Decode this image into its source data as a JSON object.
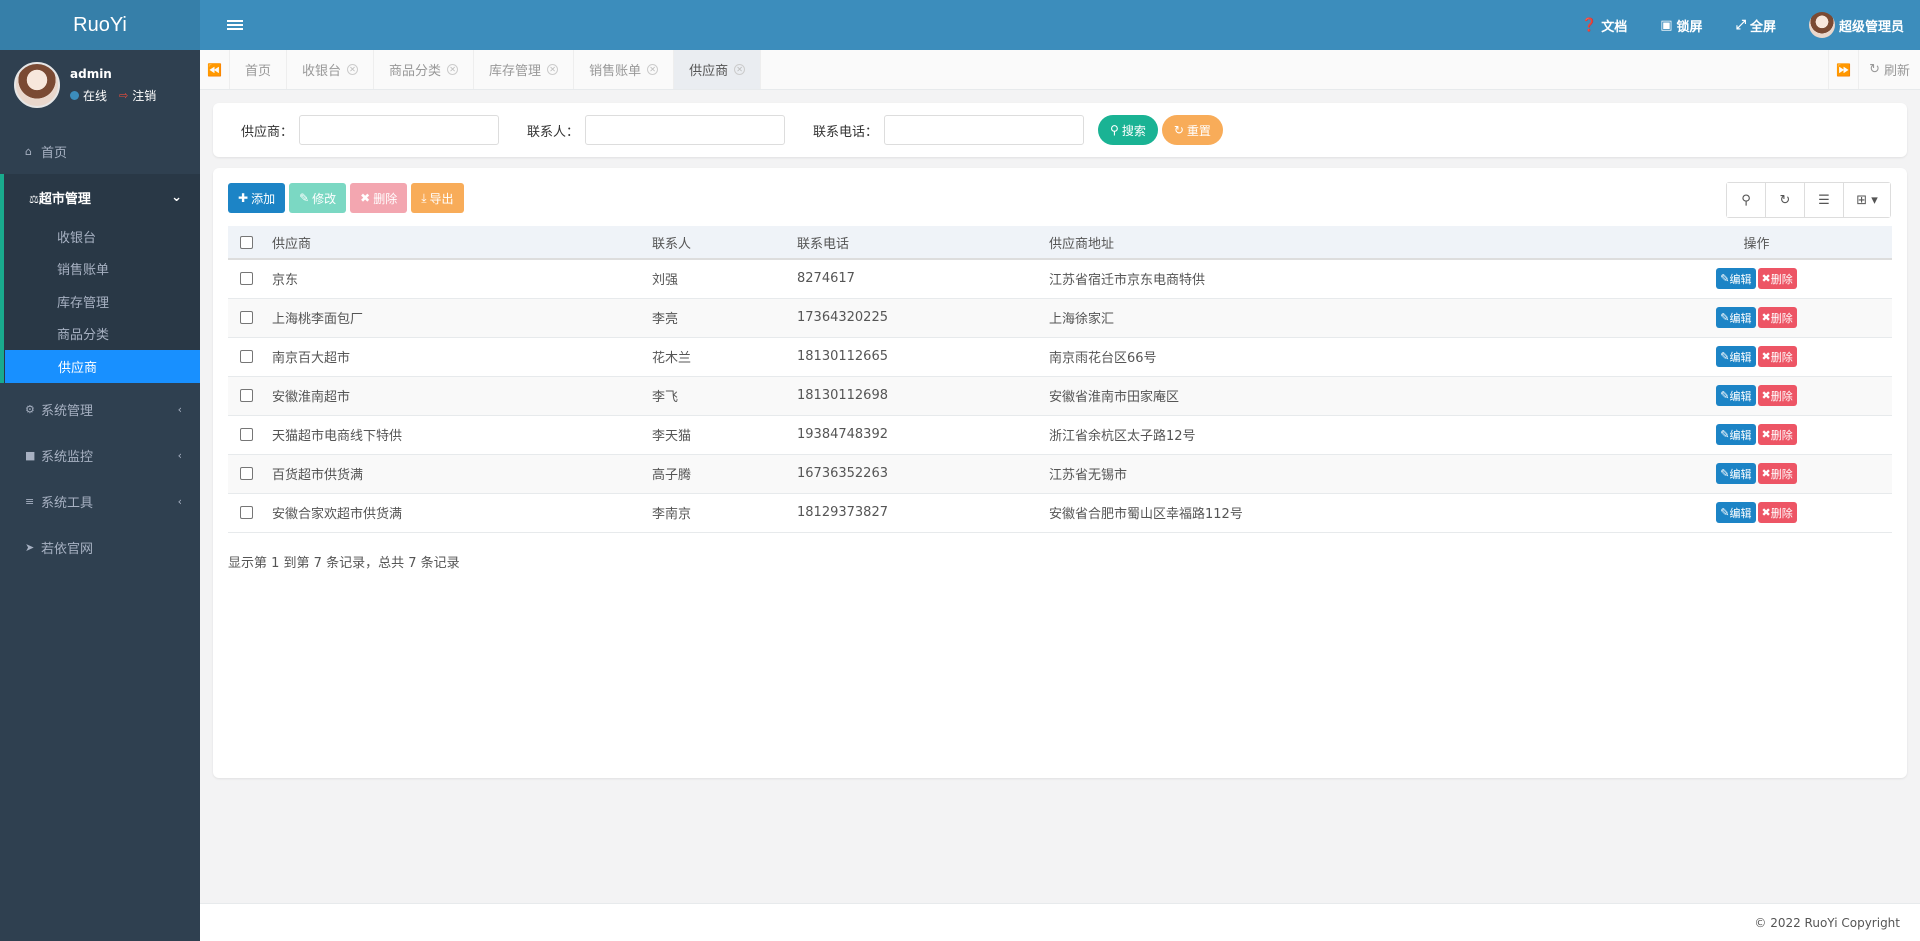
{
  "app": {
    "logo": "RuoYi"
  },
  "user": {
    "name": "admin",
    "status_online": "在线",
    "logout": "注销"
  },
  "sidebar": {
    "home": "首页",
    "supermarket": "超市管理",
    "sub": [
      "收银台",
      "销售账单",
      "库存管理",
      "商品分类",
      "供应商"
    ],
    "system": "系统管理",
    "monitor": "系统监控",
    "tools": "系统工具",
    "site": "若依官网"
  },
  "topbar": {
    "docs": "文档",
    "lock": "锁屏",
    "fullscreen": "全屏",
    "user": "超级管理员"
  },
  "tabs": {
    "items": [
      "首页",
      "收银台",
      "商品分类",
      "库存管理",
      "销售账单",
      "供应商"
    ],
    "active": "供应商",
    "refresh": "刷新"
  },
  "search": {
    "supplier_label": "供应商：",
    "supplier_value": "",
    "contact_label": "联系人：",
    "contact_value": "",
    "phone_label": "联系电话：",
    "phone_value": "",
    "search_btn": "搜索",
    "reset_btn": "重置"
  },
  "toolbar": {
    "add": "添加",
    "edit": "修改",
    "delete": "删除",
    "export": "导出"
  },
  "table": {
    "headers": [
      "供应商",
      "联系人",
      "联系电话",
      "供应商地址",
      "操作"
    ],
    "rows": [
      [
        "京东",
        "刘强",
        "8274617",
        "江苏省宿迁市京东电商特供"
      ],
      [
        "上海桃李面包厂",
        "李亮",
        "17364320225",
        "上海徐家汇"
      ],
      [
        "南京百大超市",
        "花木兰",
        "18130112665",
        "南京雨花台区66号"
      ],
      [
        "安徽淮南超市",
        "李飞",
        "18130112698",
        "安徽省淮南市田家庵区"
      ],
      [
        "天猫超市电商线下特供",
        "李天猫",
        "19384748392",
        "浙江省余杭区太子路12号"
      ],
      [
        "百货超市供货满",
        "高子腾",
        "16736352263",
        "江苏省无锡市"
      ],
      [
        "安徽合家欢超市供货满",
        "李南京",
        "18129373827",
        "安徽省合肥市蜀山区幸福路112号"
      ]
    ],
    "edit_label": "编辑",
    "delete_label": "删除"
  },
  "pagination": {
    "info": "显示第 1 到第 7 条记录，总共 7 条记录"
  },
  "footer": {
    "copyright": "© 2022 RuoYi Copyright"
  },
  "colors": {
    "sidebar": "#2f4050",
    "topbar": "#3c8dbc",
    "active": "#1890ff",
    "primary": "#1c84c6",
    "success": "#1ab394",
    "warning": "#f8ac59",
    "danger": "#ed5565"
  }
}
